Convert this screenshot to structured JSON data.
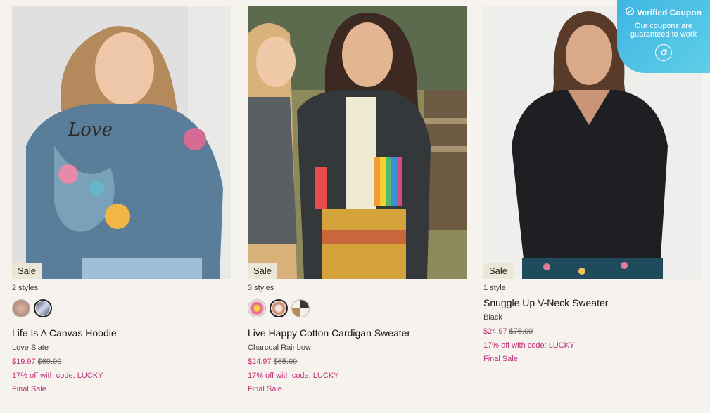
{
  "products": [
    {
      "badge": "Sale",
      "styles": "2 styles",
      "name": "Life Is A Canvas Hoodie",
      "color": "Love Slate",
      "price": "$19.97",
      "original_price": "$69.00",
      "promo": "17% off with code: LUCKY",
      "final": "Final Sale",
      "swatches": [
        "#c79a86",
        "#5d6f9e"
      ]
    },
    {
      "badge": "Sale",
      "styles": "3 styles",
      "name": "Live Happy Cotton Cardigan Sweater",
      "color": "Charcoal Rainbow",
      "price": "$24.97",
      "original_price": "$65.00",
      "promo": "17% off with code: LUCKY",
      "final": "Final Sale",
      "swatches": [
        "#e25a8c",
        "#c7846a",
        "#3a3530"
      ]
    },
    {
      "badge": "Sale",
      "styles": "1 style",
      "name": "Snuggle Up V-Neck Sweater",
      "color": "Black",
      "price": "$24.97",
      "original_price": "$75.00",
      "promo": "17% off with code: LUCKY",
      "final": "Final Sale",
      "swatches": []
    }
  ],
  "coupon": {
    "title": "Verified Coupon",
    "line1": "Our coupons are",
    "line2": "guaranteed to work"
  },
  "colors": {
    "accent": "#c0307a",
    "coupon_bg": "#4cc2e6"
  }
}
